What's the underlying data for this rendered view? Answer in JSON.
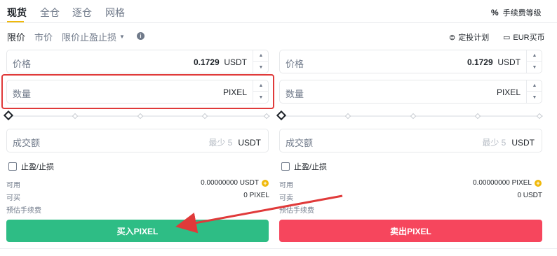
{
  "tabs": [
    {
      "label": "现货"
    },
    {
      "label": "全仓"
    },
    {
      "label": "逐仓"
    },
    {
      "label": "网格"
    }
  ],
  "fee_level": {
    "label": "手续费等级",
    "icon": "percent-icon"
  },
  "order_types": [
    {
      "label": "限价"
    },
    {
      "label": "市价"
    },
    {
      "label": "限价止盈止损"
    }
  ],
  "links": {
    "recurring_plan": "定投计划",
    "eur_buy": "EUR买币"
  },
  "buy": {
    "price_label": "价格",
    "price_value": "0.1729",
    "price_unit": "USDT",
    "amount_label": "数量",
    "amount_unit": "PIXEL",
    "total_label": "成交额",
    "total_min": "最少 5",
    "total_unit": "USDT",
    "tpsl_label": "止盈/止损",
    "available_label": "可用",
    "available_value": "0.00000000 USDT",
    "can_label": "可买",
    "can_value": "0 PIXEL",
    "fee_label": "预估手续费",
    "button_label": "买入PIXEL"
  },
  "sell": {
    "price_label": "价格",
    "price_value": "0.1729",
    "price_unit": "USDT",
    "amount_label": "数量",
    "amount_unit": "PIXEL",
    "total_label": "成交额",
    "total_min": "最少 5",
    "total_unit": "USDT",
    "tpsl_label": "止盈/止损",
    "available_label": "可用",
    "available_value": "0.00000000 PIXEL",
    "can_label": "可卖",
    "can_value": "0 USDT",
    "fee_label": "预估手续费",
    "button_label": "卖出PIXEL"
  },
  "colors": {
    "buy": "#2ebd85",
    "sell": "#f6465d",
    "accent": "#f0b90b",
    "annotation": "#e03a3a"
  }
}
